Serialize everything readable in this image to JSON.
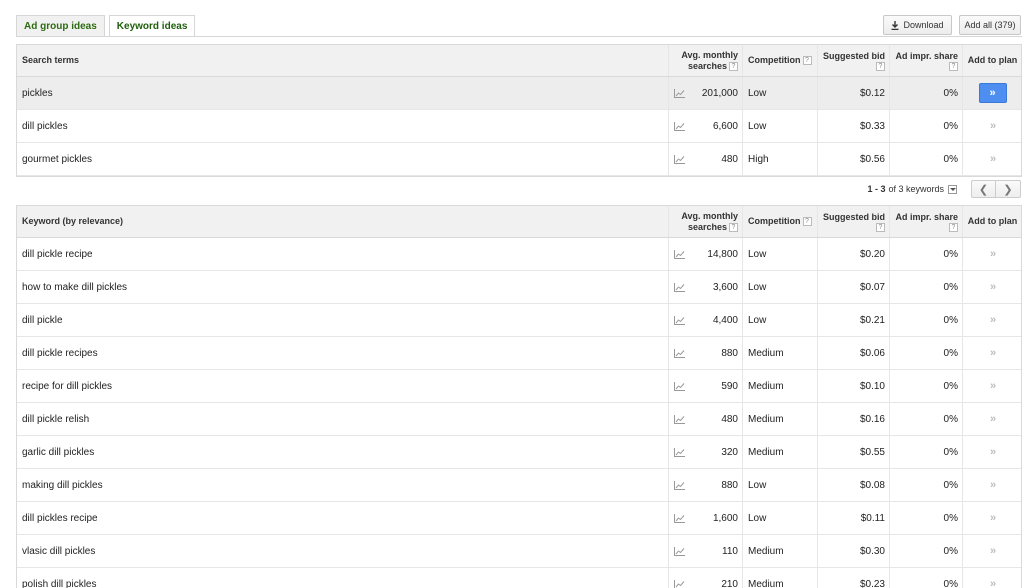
{
  "tabs": [
    {
      "label": "Ad group ideas"
    },
    {
      "label": "Keyword ideas"
    }
  ],
  "toolbar": {
    "download_label": "Download",
    "add_all_label": "Add all (379)"
  },
  "search_table": {
    "headers": {
      "term": "Search terms",
      "avg_line1": "Avg. monthly",
      "avg_line2": "searches",
      "competition": "Competition",
      "bid": "Suggested bid",
      "impr": "Ad impr. share",
      "add": "Add to plan"
    },
    "help_glyph": "?",
    "rows": [
      {
        "term": "pickles",
        "avg": "201,000",
        "competition": "Low",
        "bid": "$0.12",
        "impr": "0%"
      },
      {
        "term": "dill pickles",
        "avg": "6,600",
        "competition": "Low",
        "bid": "$0.33",
        "impr": "0%"
      },
      {
        "term": "gourmet pickles",
        "avg": "480",
        "competition": "High",
        "bid": "$0.56",
        "impr": "0%"
      }
    ]
  },
  "pager": {
    "range": "1 - 3",
    "text": "of 3 keywords",
    "prev_glyph": "❮",
    "next_glyph": "❯"
  },
  "keyword_table": {
    "headers": {
      "term": "Keyword (by relevance)",
      "avg_line1": "Avg. monthly",
      "avg_line2": "searches",
      "competition": "Competition",
      "bid": "Suggested bid",
      "impr": "Ad impr. share",
      "add": "Add to plan"
    },
    "rows": [
      {
        "term": "dill pickle recipe",
        "avg": "14,800",
        "competition": "Low",
        "bid": "$0.20",
        "impr": "0%"
      },
      {
        "term": "how to make dill pickles",
        "avg": "3,600",
        "competition": "Low",
        "bid": "$0.07",
        "impr": "0%"
      },
      {
        "term": "dill pickle",
        "avg": "4,400",
        "competition": "Low",
        "bid": "$0.21",
        "impr": "0%"
      },
      {
        "term": "dill pickle recipes",
        "avg": "880",
        "competition": "Medium",
        "bid": "$0.06",
        "impr": "0%"
      },
      {
        "term": "recipe for dill pickles",
        "avg": "590",
        "competition": "Medium",
        "bid": "$0.10",
        "impr": "0%"
      },
      {
        "term": "dill pickle relish",
        "avg": "480",
        "competition": "Medium",
        "bid": "$0.16",
        "impr": "0%"
      },
      {
        "term": "garlic dill pickles",
        "avg": "320",
        "competition": "Medium",
        "bid": "$0.55",
        "impr": "0%"
      },
      {
        "term": "making dill pickles",
        "avg": "880",
        "competition": "Low",
        "bid": "$0.08",
        "impr": "0%"
      },
      {
        "term": "dill pickles recipe",
        "avg": "1,600",
        "competition": "Low",
        "bid": "$0.11",
        "impr": "0%"
      },
      {
        "term": "vlasic dill pickles",
        "avg": "110",
        "competition": "Medium",
        "bid": "$0.30",
        "impr": "0%"
      },
      {
        "term": "polish dill pickles",
        "avg": "210",
        "competition": "Medium",
        "bid": "$0.23",
        "impr": "0%"
      }
    ]
  },
  "add_glyph": "»",
  "colors": {
    "tab_text": "#2c6b10",
    "add_button": "#4d8ef0",
    "header_bg": "#f1f1f1",
    "highlight_row": "#ededed"
  }
}
